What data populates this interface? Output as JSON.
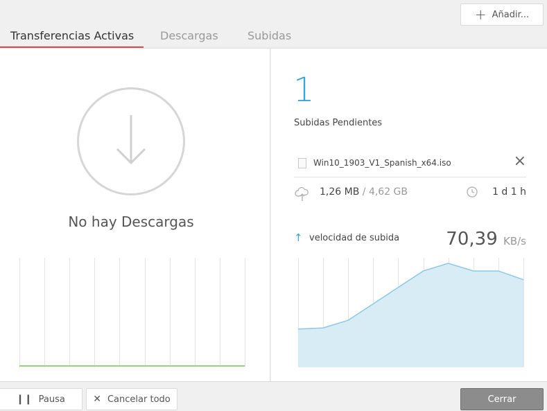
{
  "header": {
    "add_label": "Añadir...",
    "tabs": [
      {
        "label": "Transferencias Activas",
        "active": true
      },
      {
        "label": "Descargas",
        "active": false
      },
      {
        "label": "Subidas",
        "active": false
      }
    ]
  },
  "downloads": {
    "empty_text": "No hay Descargas"
  },
  "uploads": {
    "pending_count": "1",
    "pending_label": "Subidas Pendientes",
    "file_name": "Win10_1903_V1_Spanish_x64.iso",
    "size_done": "1,26 MB",
    "size_separator": "/",
    "size_total": "4,62 GB",
    "time_left": "1 d 1 h",
    "speed_label": "velocidad de subida",
    "speed_value": "70,39",
    "speed_unit": "KB/s"
  },
  "chart_data": [
    {
      "type": "line",
      "description_label": "",
      "x": [
        0,
        1,
        2,
        3,
        4,
        5,
        6,
        7,
        8,
        9
      ],
      "values": [
        0,
        0,
        0,
        0,
        0,
        0,
        0,
        0,
        0,
        0
      ]
    },
    {
      "type": "area",
      "x": [
        0,
        1,
        2,
        3,
        4,
        5,
        6,
        7,
        8,
        9
      ],
      "values": [
        35,
        36,
        43,
        58,
        73,
        88,
        95,
        88,
        88,
        80
      ],
      "ylim": [
        0,
        100
      ]
    }
  ],
  "footer": {
    "pause_label": "Pausa",
    "cancel_label": "Cancelar todo",
    "close_label": "Cerrar"
  },
  "colors": {
    "accent_red": "#e0464c",
    "accent_blue": "#3aa4d8",
    "area_fill": "#d8ecf6",
    "area_line": "#8cc8e6",
    "flat_line": "#9bd17d"
  }
}
